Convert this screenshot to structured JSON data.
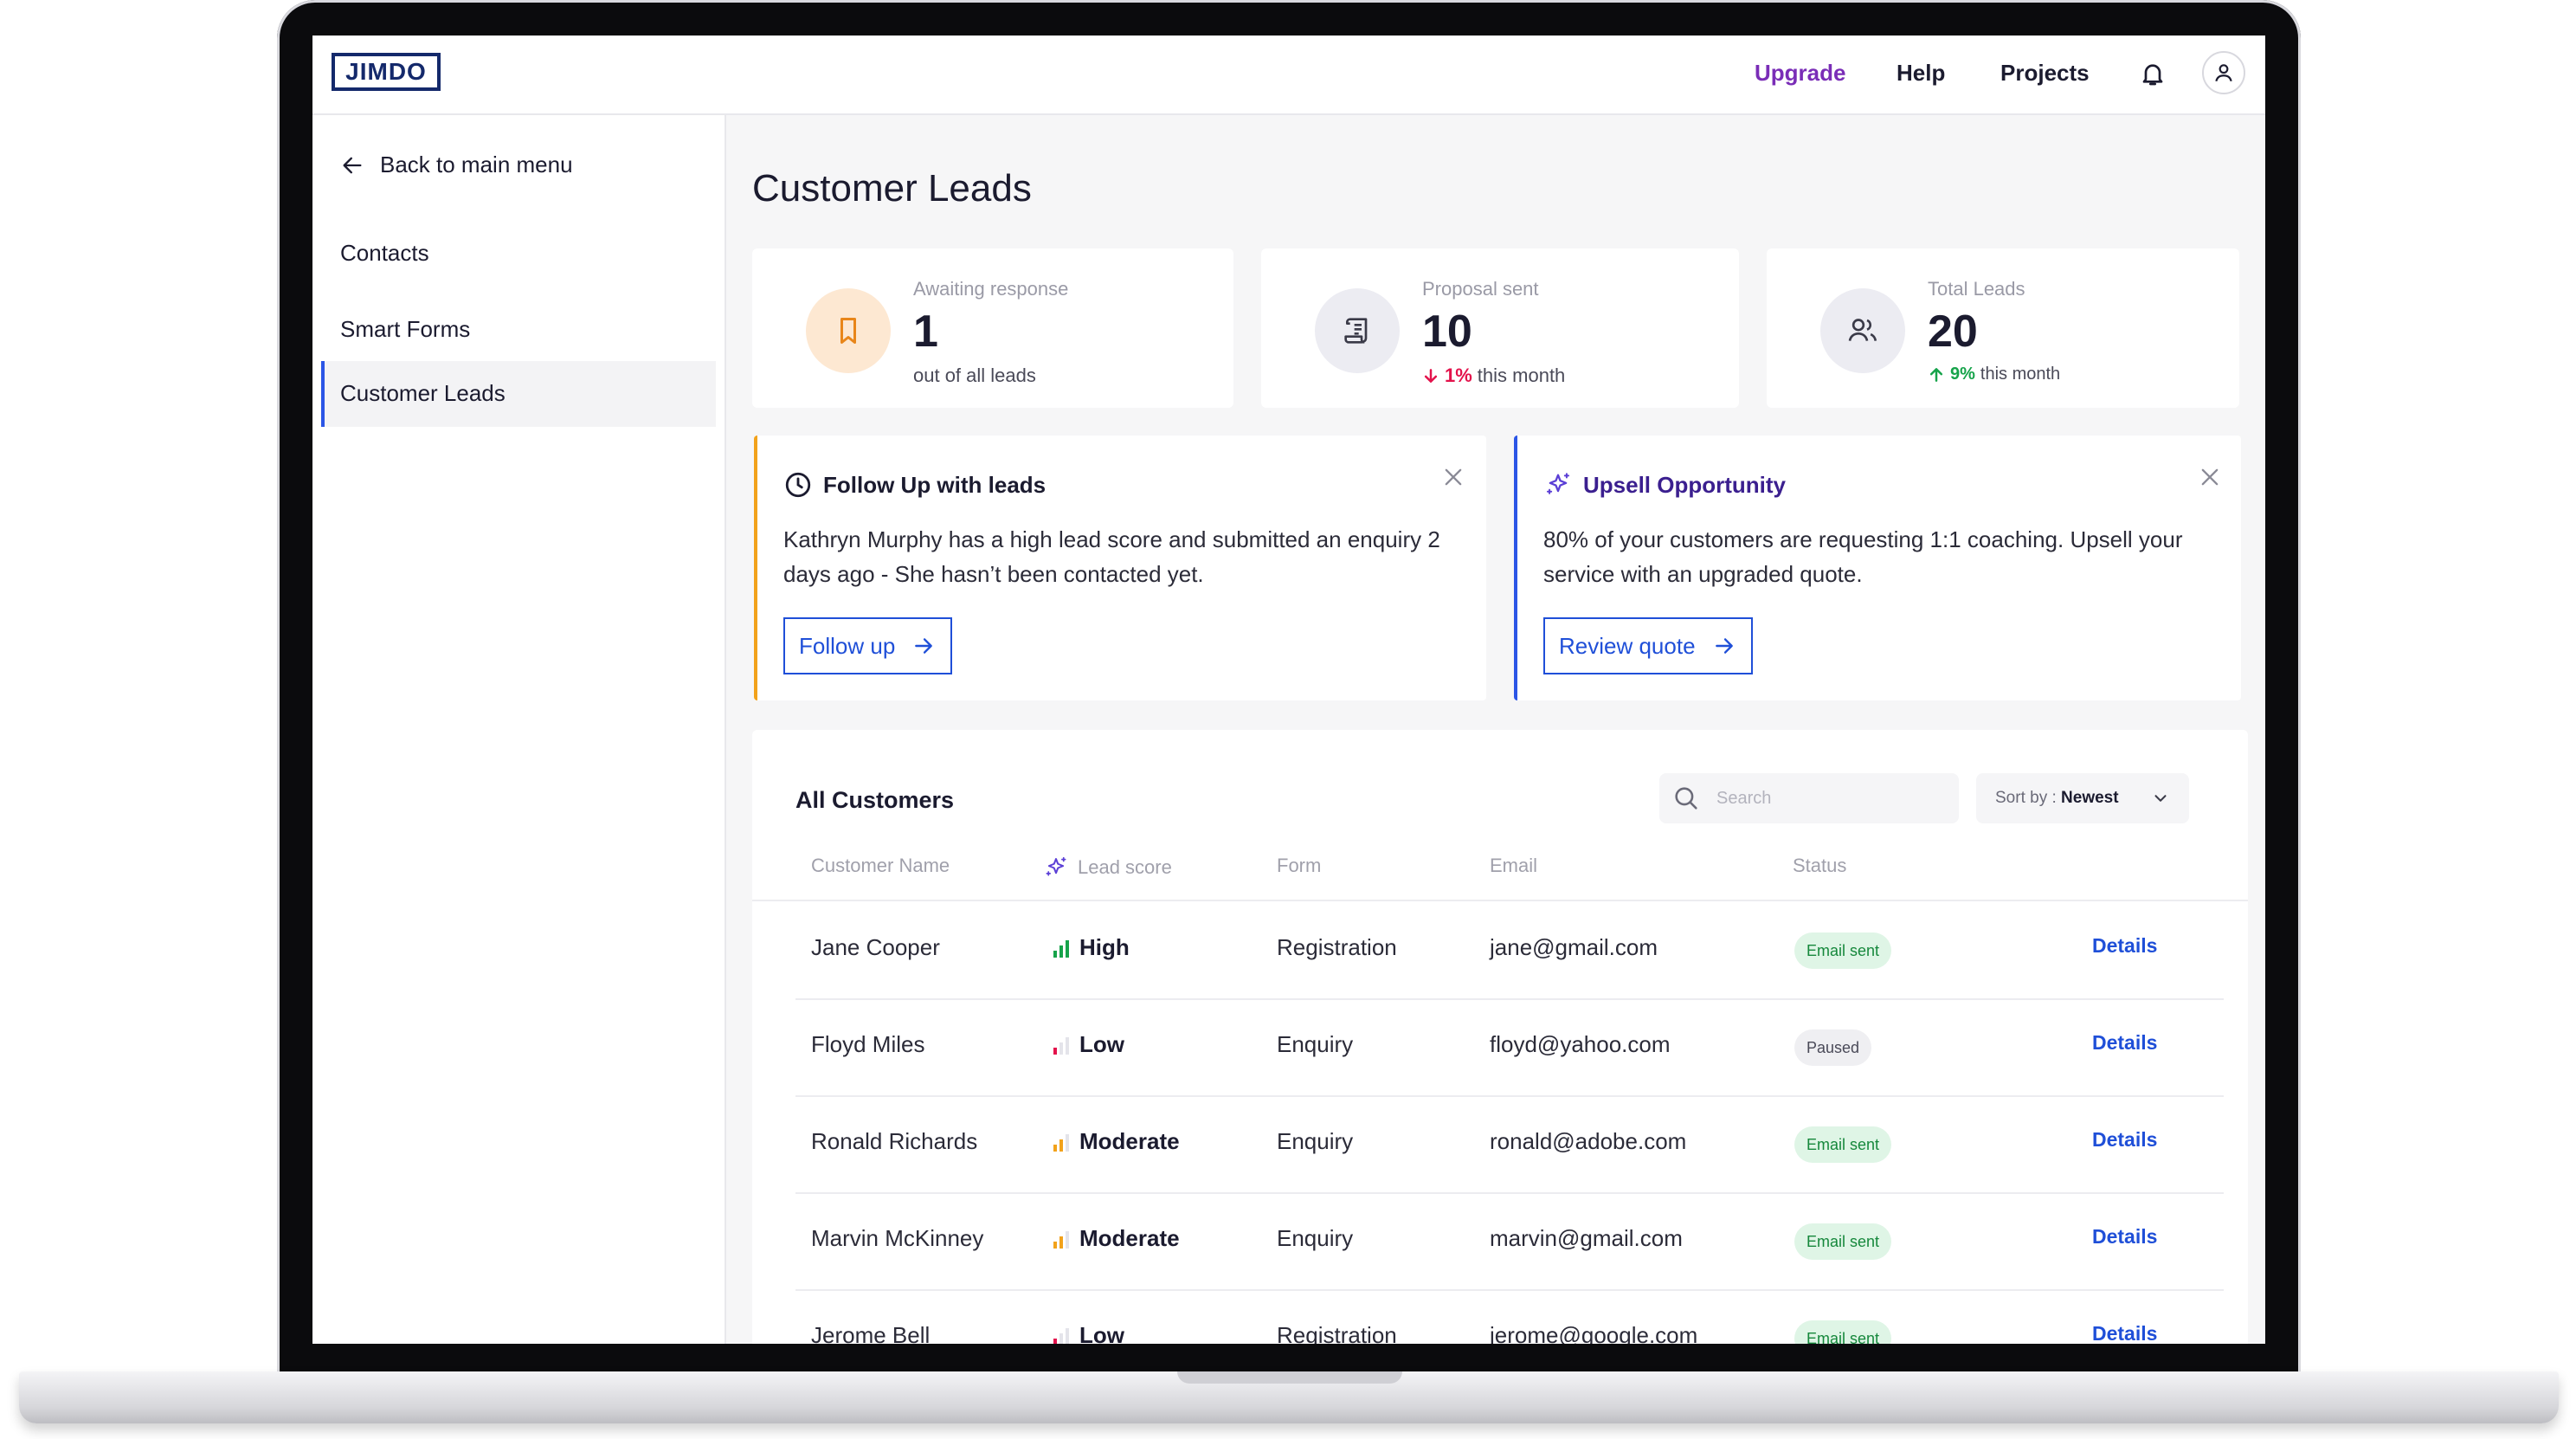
{
  "header": {
    "logo": "JIMDO",
    "nav": [
      "Upgrade",
      "Help",
      "Projects"
    ]
  },
  "sidebar": {
    "back_label": "Back to main menu",
    "items": [
      "Contacts",
      "Smart Forms",
      "Customer Leads"
    ],
    "active": "Customer Leads"
  },
  "page": {
    "title": "Customer Leads"
  },
  "stats": [
    {
      "label": "Awaiting response",
      "value": "1",
      "sub": "out of all leads"
    },
    {
      "label": "Proposal sent",
      "value": "10",
      "pct": "1%",
      "sub": "this month",
      "trend": "down"
    },
    {
      "label": "Total Leads",
      "value": "20",
      "pct": "9%",
      "sub": "this month",
      "trend": "up"
    }
  ],
  "insights": {
    "follow_up": {
      "title": "Follow Up with leads",
      "body": "Kathryn Murphy has a high lead score and submitted an enquiry 2 days ago - She hasn’t been contacted yet.",
      "cta": "Follow up"
    },
    "upsell": {
      "title": "Upsell Opportunity",
      "body": "80% of your customers are requesting 1:1 coaching. Upsell your service with an upgraded quote.",
      "cta": "Review quote"
    }
  },
  "customers": {
    "title": "All Customers",
    "search_placeholder": "Search",
    "sort_prefix": "Sort by : ",
    "sort_value": "Newest",
    "columns": [
      "Customer Name",
      "Lead score",
      "Form",
      "Email",
      "Status"
    ],
    "rows": [
      {
        "name": "Jane Cooper",
        "score": "High",
        "form": "Registration",
        "email": "jane@gmail.com",
        "status": "Email sent",
        "action": "Details"
      },
      {
        "name": "Floyd Miles",
        "score": "Low",
        "form": "Enquiry",
        "email": "floyd@yahoo.com",
        "status": "Paused",
        "action": "Details"
      },
      {
        "name": "Ronald Richards",
        "score": "Moderate",
        "form": "Enquiry",
        "email": "ronald@adobe.com",
        "status": "Email sent",
        "action": "Details"
      },
      {
        "name": "Marvin McKinney",
        "score": "Moderate",
        "form": "Enquiry",
        "email": "marvin@gmail.com",
        "status": "Email sent",
        "action": "Details"
      },
      {
        "name": "Jerome Bell",
        "score": "Low",
        "form": "Registration",
        "email": "jerome@google.com",
        "status": "Email sent",
        "action": "Details"
      }
    ]
  },
  "colors": {
    "accent_blue": "#1f4fd8",
    "upgrade_purple": "#7a2db7",
    "score_high": "#16a34a",
    "score_moderate": "#f2a21b",
    "score_low": "#e3124b",
    "follow_up_border": "#f2a21b",
    "upsell_border": "#2b55e6"
  }
}
